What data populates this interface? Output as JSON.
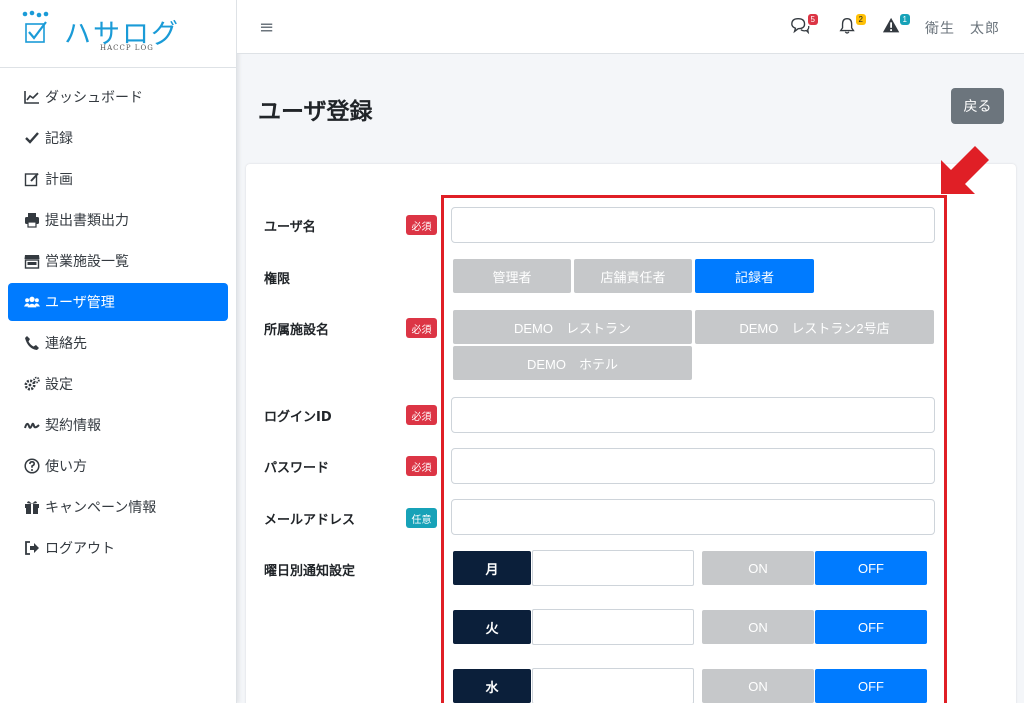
{
  "brand": {
    "logo_text": "ハサログ",
    "logo_sub": "HACCP LOG"
  },
  "sidebar": {
    "items": [
      {
        "label": "ダッシュボード",
        "icon": "chart-line-icon"
      },
      {
        "label": "記録",
        "icon": "check-icon"
      },
      {
        "label": "計画",
        "icon": "edit-icon"
      },
      {
        "label": "提出書類出力",
        "icon": "printer-icon"
      },
      {
        "label": "営業施設一覧",
        "icon": "store-icon"
      },
      {
        "label": "ユーザ管理",
        "icon": "users-icon",
        "active": true
      },
      {
        "label": "連絡先",
        "icon": "phone-icon"
      },
      {
        "label": "設定",
        "icon": "gears-icon"
      },
      {
        "label": "契約情報",
        "icon": "signature-icon"
      },
      {
        "label": "使い方",
        "icon": "question-circle-icon"
      },
      {
        "label": "キャンペーン情報",
        "icon": "gift-icon"
      },
      {
        "label": "ログアウト",
        "icon": "sign-out-icon"
      }
    ]
  },
  "topbar": {
    "hamburger": "≡",
    "messages_count": "5",
    "notifications_count": "2",
    "alerts_count": "1",
    "user_name": "衛生　太郎"
  },
  "page": {
    "title": "ユーザ登録",
    "back_label": "戻る"
  },
  "form": {
    "username_label": "ユーザ名",
    "required_badge": "必須",
    "optional_badge": "任意",
    "role_label": "権限",
    "roles": [
      "管理者",
      "店舗責任者",
      "記録者"
    ],
    "role_selected": "記録者",
    "facility_label": "所属施設名",
    "facilities": [
      "DEMO　レストラン",
      "DEMO　レストラン2号店",
      "DEMO　ホテル"
    ],
    "login_id_label": "ログインID",
    "password_label": "パスワード",
    "email_label": "メールアドレス",
    "weekday_label": "曜日別通知設定",
    "weekdays": [
      "月",
      "火",
      "水"
    ],
    "on_label": "ON",
    "off_label": "OFF",
    "weekday_state": [
      "OFF",
      "OFF",
      "OFF"
    ]
  },
  "colors": {
    "primary": "#007bff",
    "danger": "#dc3545",
    "info": "#17a2b8",
    "secondary": "#6c757d",
    "highlight": "#e01f26",
    "weekday_dark": "#0b1f3a"
  }
}
